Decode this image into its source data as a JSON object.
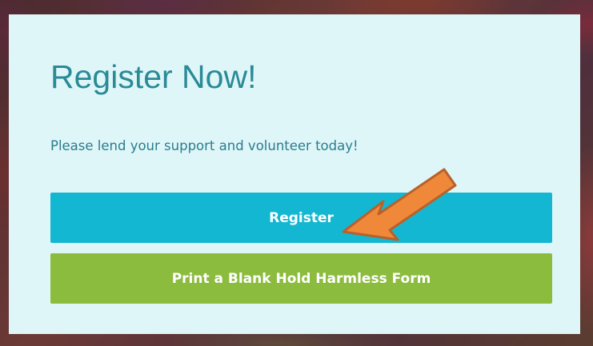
{
  "card": {
    "title": "Register Now!",
    "subtitle": "Please lend your support and volunteer today!"
  },
  "buttons": {
    "register_label": "Register",
    "print_label": "Print a Blank Hold Harmless Form"
  },
  "colors": {
    "card_bg": "#dff6f9",
    "title": "#2a8a96",
    "register_button": "#14b7d1",
    "print_button": "#8cbc3e",
    "arrow": "#f0883a"
  },
  "annotation": {
    "icon": "pointing-arrow-icon"
  }
}
